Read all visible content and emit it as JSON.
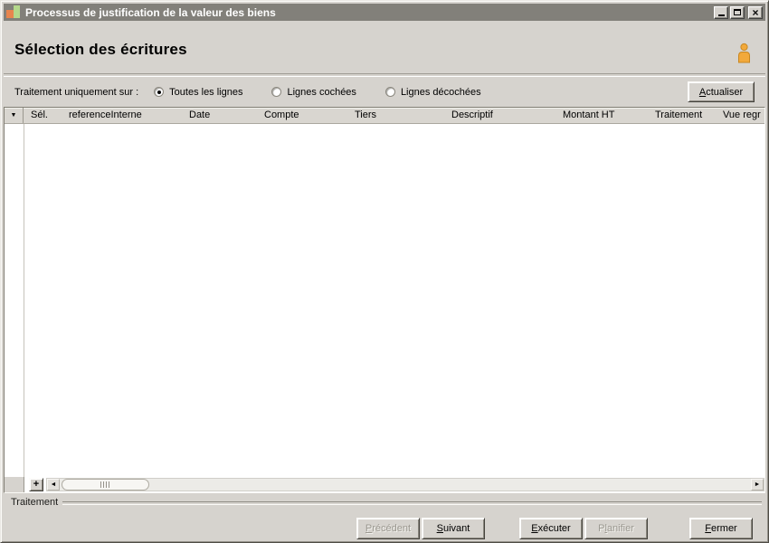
{
  "window": {
    "title": "Processus de justification de la valeur des biens"
  },
  "icons": {
    "close": "×",
    "column_selector": "▼",
    "scroll_left": "◄",
    "scroll_right": "►",
    "add_row": "+",
    "user": "person-icon",
    "app": "bar-chart-icon"
  },
  "header": {
    "title": "Sélection des écritures"
  },
  "filter": {
    "label": "Traitement uniquement sur :",
    "options": [
      {
        "label": "Toutes les lignes",
        "selected": true
      },
      {
        "label": "Lignes cochées",
        "selected": false
      },
      {
        "label": "Lignes décochées",
        "selected": false
      }
    ],
    "refresh": {
      "pre": "",
      "key": "A",
      "post": "ctualiser"
    }
  },
  "table": {
    "columns": [
      "Sél.",
      "referenceInterne",
      "Date",
      "Compte",
      "Tiers",
      "Descriptif",
      "Montant HT",
      "Traitement",
      "Vue regr"
    ],
    "rows": []
  },
  "footer": {
    "group_label": "Traitement",
    "buttons": [
      {
        "pre": "",
        "key": "P",
        "post": "récédent",
        "label": "Précédent",
        "enabled": false
      },
      {
        "pre": "",
        "key": "S",
        "post": "uivant",
        "label": "Suivant",
        "enabled": true
      },
      {
        "pre": "",
        "key": "E",
        "post": "xécuter",
        "label": "Exécuter",
        "enabled": true
      },
      {
        "pre": "P",
        "key": "l",
        "post": "anifier",
        "label": "Planifier",
        "enabled": false
      },
      {
        "pre": "",
        "key": "F",
        "post": "ermer",
        "label": "Fermer",
        "enabled": true
      }
    ]
  },
  "colors": {
    "titlebar": "#82807A",
    "window_bg": "#D6D3CE",
    "table_bg": "#FFFFFF",
    "header_row_bg": "#D9D6D0",
    "user_icon_fill": "#F2A93B",
    "user_icon_stroke": "#C9871F",
    "app_icon_orange": "#E8854E",
    "app_icon_green": "#B4D88B",
    "disabled_text": "#9B9890"
  }
}
